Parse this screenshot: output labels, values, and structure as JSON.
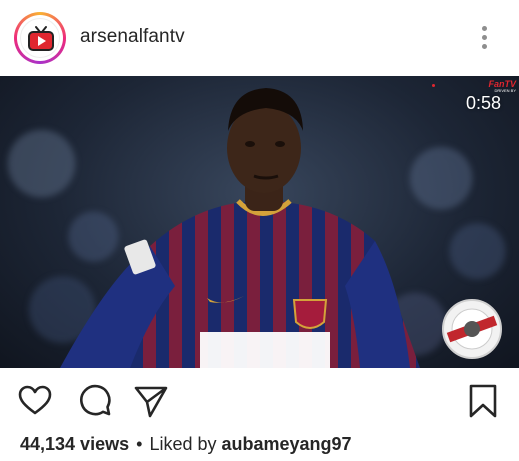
{
  "post": {
    "username": "arsenalfantv",
    "avatar_icon": "tv-play-icon",
    "video": {
      "timer": "0:58",
      "watermark_brand": "FanTV",
      "watermark_sub": "DRIVEN BY",
      "badge_icon": "award-badge-icon"
    }
  },
  "actions": {
    "like_icon": "heart-icon",
    "comment_icon": "comment-bubble-icon",
    "share_icon": "paper-plane-icon",
    "save_icon": "bookmark-icon"
  },
  "meta": {
    "views": "44,134 views",
    "separator": "•",
    "liked_by_prefix": "Liked by",
    "liked_by_user": "aubameyang97"
  },
  "colors": {
    "text": "#262626",
    "secondary": "#8e8e8e",
    "accent_red": "#e0262f"
  }
}
